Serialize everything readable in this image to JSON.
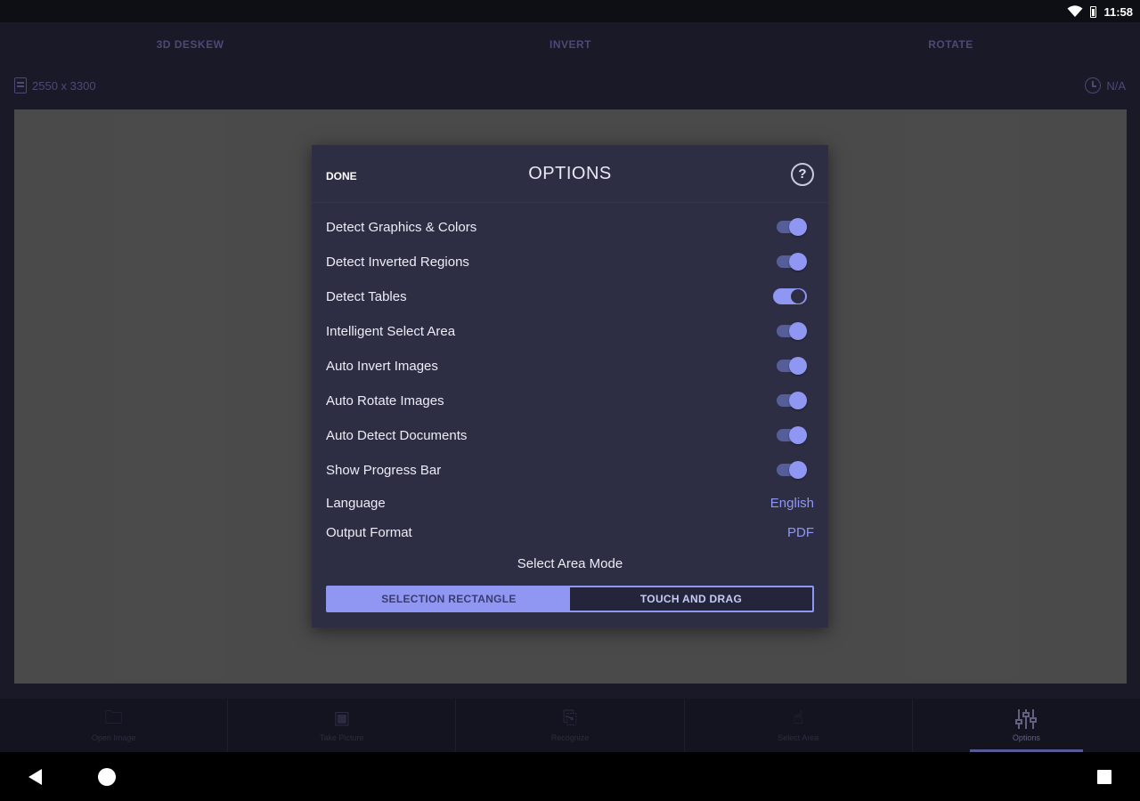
{
  "status_bar": {
    "time": "11:58",
    "icons": [
      "wifi-icon",
      "battery-icon"
    ]
  },
  "top_tabs": [
    "3D DESKEW",
    "INVERT",
    "ROTATE"
  ],
  "info": {
    "dimensions": "2550 x 3300",
    "time_value": "N/A"
  },
  "bottom_nav": [
    {
      "icon": "open-image-icon",
      "label": "Open Image",
      "active": false
    },
    {
      "icon": "take-picture-icon",
      "label": "Take Picture",
      "active": false
    },
    {
      "icon": "pdf-icon",
      "label": "Recognize",
      "active": false
    },
    {
      "icon": "select-area-icon",
      "label": "Select Area",
      "active": false
    },
    {
      "icon": "sliders-icon",
      "label": "Options",
      "active": true
    }
  ],
  "dialog": {
    "done_label": "DONE",
    "title": "OPTIONS",
    "help_glyph": "?",
    "toggles": [
      {
        "label": "Detect Graphics & Colors",
        "on": true
      },
      {
        "label": "Detect Inverted Regions",
        "on": true
      },
      {
        "label": "Detect Tables",
        "on": false
      },
      {
        "label": "Intelligent Select Area",
        "on": true
      },
      {
        "label": "Auto Invert Images",
        "on": true
      },
      {
        "label": "Auto Rotate Images",
        "on": true
      },
      {
        "label": "Auto Detect Documents",
        "on": true
      },
      {
        "label": "Show Progress Bar",
        "on": true
      }
    ],
    "language": {
      "label": "Language",
      "value": "English"
    },
    "output_format": {
      "label": "Output Format",
      "value": "PDF"
    },
    "select_area_mode": {
      "title": "Select Area Mode",
      "options": [
        "SELECTION RECTANGLE",
        "TOUCH AND DRAG"
      ],
      "selected": "SELECTION RECTANGLE"
    }
  },
  "colors": {
    "accent": "#8f97f2",
    "dialog_bg": "#2d2e44",
    "app_bg": "#24243a",
    "preview_bg": "#6b6b6b"
  }
}
